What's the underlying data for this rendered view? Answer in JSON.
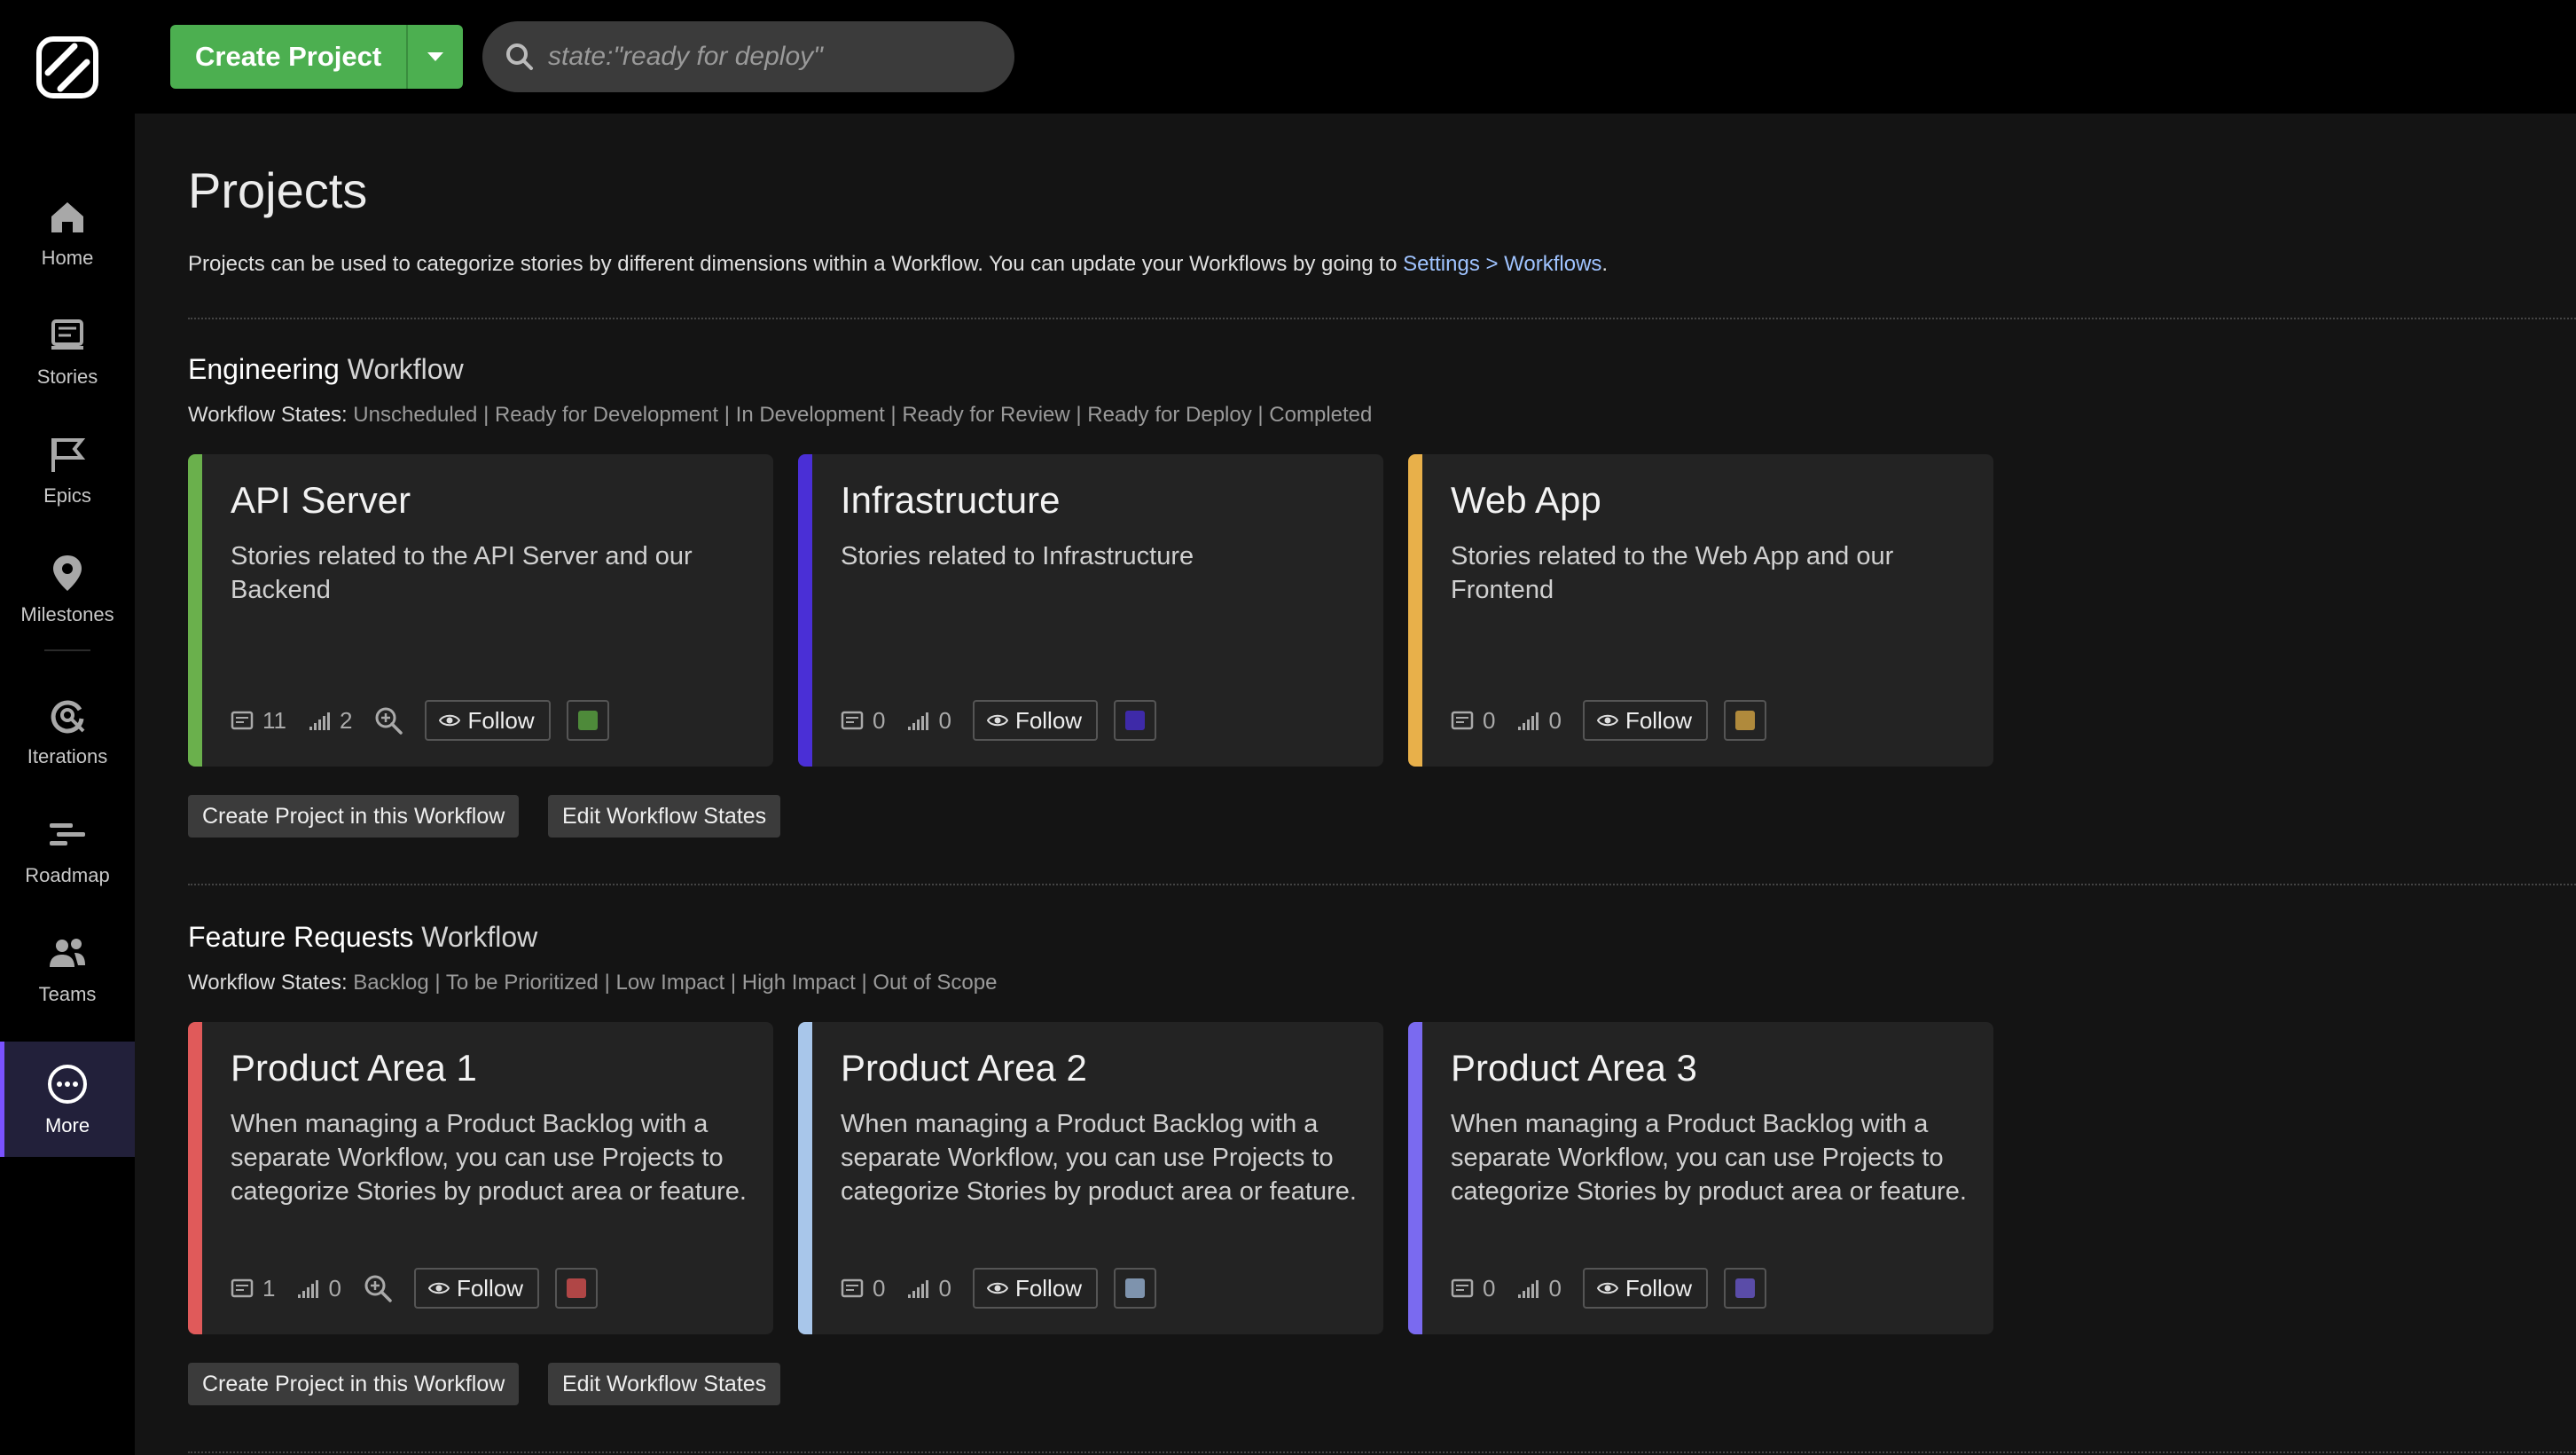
{
  "nav": {
    "items": [
      {
        "label": "Home"
      },
      {
        "label": "Stories"
      },
      {
        "label": "Epics"
      },
      {
        "label": "Milestones"
      },
      {
        "label": "Iterations"
      },
      {
        "label": "Roadmap"
      },
      {
        "label": "Teams"
      },
      {
        "label": "More"
      }
    ],
    "active": "More",
    "accent": "#7a52ff"
  },
  "topbar": {
    "create_label": "Create Project",
    "search_placeholder": "state:\"ready for deploy\""
  },
  "page": {
    "title": "Projects",
    "intro_text": "Projects can be used to categorize stories by different dimensions within a Workflow. You can update your Workflows by going to ",
    "intro_link": "Settings > Workflows",
    "intro_end": "."
  },
  "workflows": [
    {
      "name": "Engineering",
      "suffix": "Workflow",
      "states_label": "Workflow States:",
      "states": "Unscheduled | Ready for Development | In Development | Ready for Review | Ready for Deploy | Completed",
      "create_label": "Create Project in this Workflow",
      "edit_label": "Edit Workflow States",
      "projects": [
        {
          "name": "API Server",
          "description": "Stories related to the API Server and our Backend",
          "stories": "11",
          "points": "2",
          "follow": "Follow",
          "color": "#6ab04c",
          "swatch": "#4e8a3a",
          "zoom": true
        },
        {
          "name": "Infrastructure",
          "description": "Stories related to Infrastructure",
          "stories": "0",
          "points": "0",
          "follow": "Follow",
          "color": "#4a2fd6",
          "swatch": "#3e2aa8",
          "zoom": false
        },
        {
          "name": "Web App",
          "description": "Stories related to the Web App and our Frontend",
          "stories": "0",
          "points": "0",
          "follow": "Follow",
          "color": "#e8b04a",
          "swatch": "#b08a3c",
          "zoom": false
        }
      ]
    },
    {
      "name": "Feature Requests",
      "suffix": "Workflow",
      "states_label": "Workflow States:",
      "states": "Backlog | To be Prioritized | Low Impact | High Impact | Out of Scope",
      "create_label": "Create Project in this Workflow",
      "edit_label": "Edit Workflow States",
      "projects": [
        {
          "name": "Product Area 1",
          "description": "When managing a Product Backlog with a separate Workflow, you can use Projects to categorize Stories by product area or feature.",
          "stories": "1",
          "points": "0",
          "follow": "Follow",
          "color": "#e05a5a",
          "swatch": "#b04646",
          "zoom": true
        },
        {
          "name": "Product Area 2",
          "description": "When managing a Product Backlog with a separate Workflow, you can use Projects to categorize Stories by product area or feature.",
          "stories": "0",
          "points": "0",
          "follow": "Follow",
          "color": "#a8c6ea",
          "swatch": "#7e93ad",
          "zoom": false
        },
        {
          "name": "Product Area 3",
          "description": "When managing a Product Backlog with a separate Workflow, you can use Projects to categorize Stories by product area or feature.",
          "stories": "0",
          "points": "0",
          "follow": "Follow",
          "color": "#7a6af0",
          "swatch": "#5a4ca8",
          "zoom": false
        }
      ]
    }
  ]
}
